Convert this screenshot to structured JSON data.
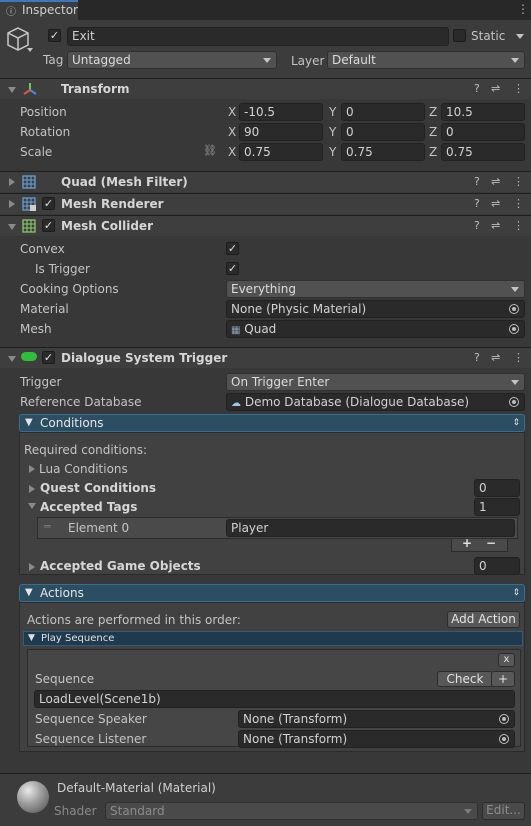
{
  "window": {
    "tab_title": "Inspector"
  },
  "object": {
    "name": "Exit",
    "static_label": "Static",
    "tag_label": "Tag",
    "tag_value": "Untagged",
    "layer_label": "Layer",
    "layer_value": "Default"
  },
  "transform": {
    "title": "Transform",
    "position": {
      "label": "Position",
      "x": "-10.5",
      "y": "0",
      "z": "10.5"
    },
    "rotation": {
      "label": "Rotation",
      "x": "90",
      "y": "0",
      "z": "0"
    },
    "scale": {
      "label": "Scale",
      "x": "0.75",
      "y": "0.75",
      "z": "0.75"
    },
    "axis": {
      "x": "X",
      "y": "Y",
      "z": "Z"
    }
  },
  "components": {
    "mesh_filter": "Quad (Mesh Filter)",
    "mesh_renderer": "Mesh Renderer",
    "mesh_collider": "Mesh Collider"
  },
  "mesh_collider": {
    "convex_label": "Convex",
    "is_trigger_label": "Is Trigger",
    "cooking_label": "Cooking Options",
    "cooking_value": "Everything",
    "material_label": "Material",
    "material_value": "None (Physic Material)",
    "mesh_label": "Mesh",
    "mesh_value": "Quad"
  },
  "dst": {
    "title": "Dialogue System Trigger",
    "trigger_label": "Trigger",
    "trigger_value": "On Trigger Enter",
    "refdb_label": "Reference Database",
    "refdb_value": "Demo Database (Dialogue Database)",
    "conditions": {
      "title": "Conditions",
      "required": "Required conditions:",
      "lua": "Lua Conditions",
      "quest": "Quest Conditions",
      "quest_count": "0",
      "accepted_tags": "Accepted Tags",
      "tags_count": "1",
      "element0_label": "Element 0",
      "element0_value": "Player",
      "add": "+",
      "remove": "−",
      "accepted_objects": "Accepted Game Objects",
      "objects_count": "0"
    },
    "actions": {
      "title": "Actions",
      "order_text": "Actions are performed in this order:",
      "add_action": "Add Action",
      "play_sequence": "Play Sequence",
      "close": "x",
      "sequence_label": "Sequence",
      "check": "Check",
      "plus": "+",
      "sequence_value": "LoadLevel(Scene1b)",
      "speaker_label": "Sequence Speaker",
      "speaker_value": "None (Transform)",
      "listener_label": "Sequence Listener",
      "listener_value": "None (Transform)"
    }
  },
  "material": {
    "name": "Default-Material (Material)",
    "shader_label": "Shader",
    "shader_value": "Standard",
    "edit": "Edit..."
  },
  "icons": {
    "settings": "?",
    "presets": "⇌",
    "menu": "⋮"
  },
  "colors": {
    "accent_blue": "#2c4e63",
    "tab_accent": "#3a79bb"
  }
}
